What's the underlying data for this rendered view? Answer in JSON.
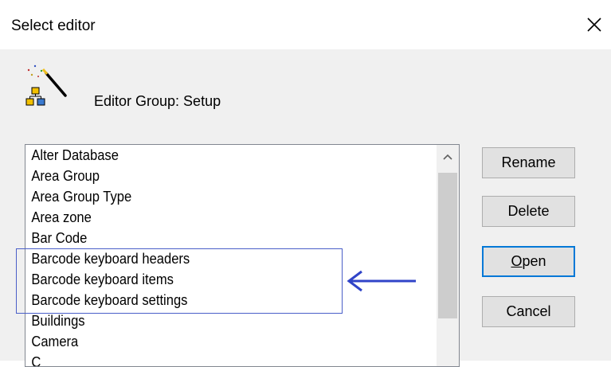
{
  "window": {
    "title": "Select editor",
    "close_icon": "close-icon"
  },
  "header": {
    "icon": "wizard-icon",
    "group_label": "Editor Group: Setup"
  },
  "list": {
    "items": [
      "Alter Database",
      "Area Group",
      "Area Group Type",
      "Area zone",
      "Bar Code",
      "Barcode keyboard headers",
      "Barcode keyboard items",
      "Barcode keyboard settings",
      "Buildings",
      "Camera",
      "C"
    ],
    "scroll_up_icon": "chevron-up-icon"
  },
  "buttons": {
    "rename": "Rename",
    "delete": "Delete",
    "open_mnemonic": "O",
    "open_rest": "pen",
    "cancel": "Cancel"
  },
  "annotation": {
    "highlight_color": "#4a5fc8",
    "arrow_icon": "left-arrow-icon"
  }
}
